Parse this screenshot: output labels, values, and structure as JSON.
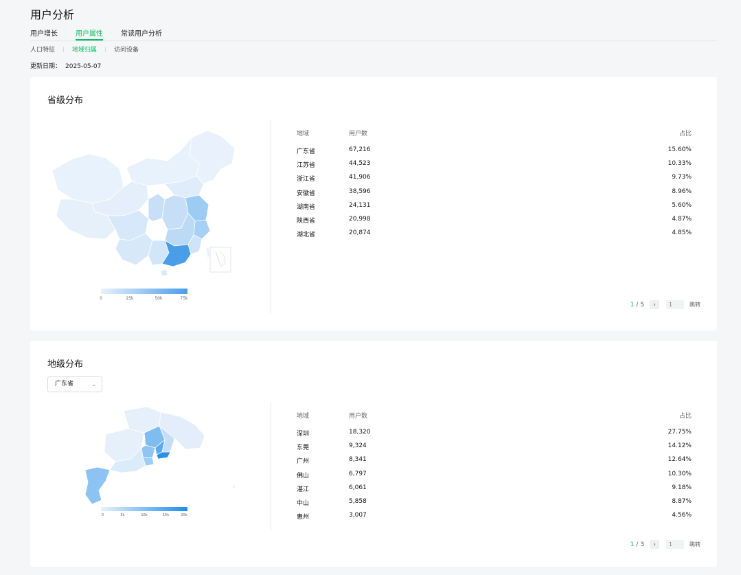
{
  "page": {
    "title": "用户分析"
  },
  "tabs": [
    {
      "label": "用户增长",
      "active": false
    },
    {
      "label": "用户属性",
      "active": true
    },
    {
      "label": "常读用户分析",
      "active": false
    }
  ],
  "subtabs": [
    {
      "label": "人口特征",
      "active": false
    },
    {
      "label": "地域归属",
      "active": true
    },
    {
      "label": "访问设备",
      "active": false
    }
  ],
  "update": {
    "label": "更新日期：",
    "value": "2025-05-07"
  },
  "colors": {
    "accent": "#07c160",
    "map_low": "#e8f2fc",
    "map_high": "#4a9ee8"
  },
  "province_section": {
    "title": "省级分布",
    "columns": [
      "地域",
      "用户数",
      "占比"
    ],
    "rows": [
      {
        "region": "广东省",
        "users": "67,216",
        "share": "15.60%"
      },
      {
        "region": "江苏省",
        "users": "44,523",
        "share": "10.33%"
      },
      {
        "region": "浙江省",
        "users": "41,906",
        "share": "9.73%"
      },
      {
        "region": "安徽省",
        "users": "38,596",
        "share": "8.96%"
      },
      {
        "region": "湖南省",
        "users": "24,131",
        "share": "5.60%"
      },
      {
        "region": "陕西省",
        "users": "20,998",
        "share": "4.87%"
      },
      {
        "region": "湖北省",
        "users": "20,874",
        "share": "4.85%"
      }
    ],
    "legend": [
      "0",
      "25k",
      "50k",
      "75k"
    ],
    "pager": {
      "current": "1",
      "total": "5",
      "input_placeholder": "1",
      "jump_label": "跳转"
    }
  },
  "city_section": {
    "title": "地级分布",
    "select_value": "广东省",
    "columns": [
      "地域",
      "用户数",
      "占比"
    ],
    "rows": [
      {
        "region": "深圳",
        "users": "18,320",
        "share": "27.75%"
      },
      {
        "region": "东莞",
        "users": "9,324",
        "share": "14.12%"
      },
      {
        "region": "广州",
        "users": "8,341",
        "share": "12.64%"
      },
      {
        "region": "佛山",
        "users": "6,797",
        "share": "10.30%"
      },
      {
        "region": "湛江",
        "users": "6,061",
        "share": "9.18%"
      },
      {
        "region": "中山",
        "users": "5,858",
        "share": "8.87%"
      },
      {
        "region": "惠州",
        "users": "3,007",
        "share": "4.56%"
      }
    ],
    "legend": [
      "0",
      "5k",
      "10k",
      "15k",
      "20k"
    ],
    "pager": {
      "current": "1",
      "total": "3",
      "input_placeholder": "1",
      "jump_label": "跳转"
    }
  }
}
